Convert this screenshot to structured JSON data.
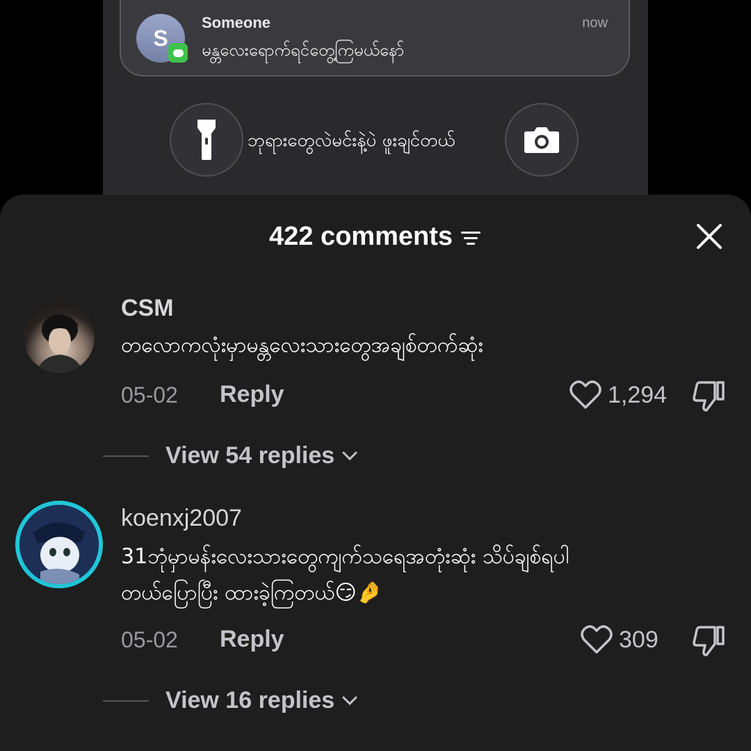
{
  "notification": {
    "avatar_letter": "S",
    "title": "Someone",
    "time": "now",
    "message": "မန္တလေးရောက်ရင်တွေ့ကြမယ်နော်"
  },
  "lockscreen": {
    "caption": "ဘုရားတွေလဲမင်းနဲ့ပဲ ဖူးချင်တယ်",
    "left_button_icon": "flashlight-icon",
    "right_button_icon": "camera-icon"
  },
  "comments_sheet": {
    "count_label": "422 comments",
    "comments": [
      {
        "username": "CSM",
        "text_lines": [
          "တလောကလုံးမှာမန္တလေးသားတွေအချစ်တက်ဆုံး"
        ],
        "date": "05-02",
        "reply_label": "Reply",
        "likes": "1,294",
        "view_replies": "View 54 replies"
      },
      {
        "username": "koenxj2007",
        "text_lines": [
          "31ဘုံမှာမန်းလေးသားတွေကျက်သရေအတုံးဆုံး သိပ်ချစ်ရပါ",
          "တယ်ပြောပြီး ထားခဲ့ကြတယ်😏🤌"
        ],
        "date": "05-02",
        "reply_label": "Reply",
        "likes": "309",
        "view_replies": "View 16 replies"
      }
    ]
  },
  "colors": {
    "sheet_bg": "#1e1e1e",
    "avatar_ring": "#20c6d8",
    "notif_app": "#3ec24b"
  }
}
